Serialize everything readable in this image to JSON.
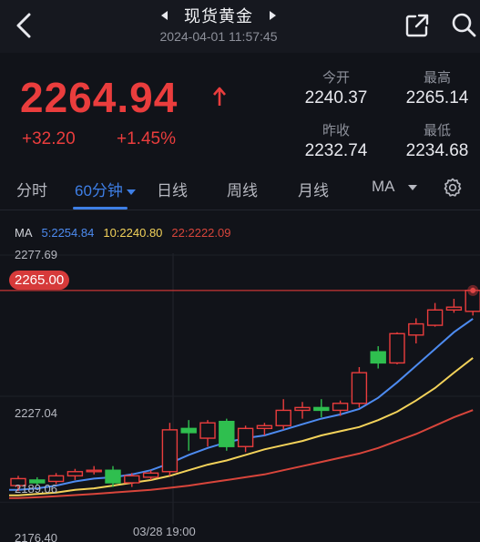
{
  "header": {
    "title": "现货黄金",
    "datetime": "2024-04-01 11:57:45"
  },
  "quote": {
    "price": "2264.94",
    "change": "+32.20",
    "change_pct": "+1.45%",
    "open_label": "今开",
    "open_value": "2240.37",
    "high_label": "最高",
    "high_value": "2265.14",
    "prev_close_label": "昨收",
    "prev_close_value": "2232.74",
    "low_label": "最低",
    "low_value": "2234.68"
  },
  "tabs": {
    "items": [
      "分时",
      "60分钟",
      "日线",
      "周线",
      "月线",
      "MA"
    ],
    "active": "60分钟"
  },
  "colors": {
    "up": "#ea3d3d",
    "down": "#2fbf4f",
    "accent": "#3e7fe6",
    "ma5": "#4d8bf0",
    "ma10": "#f3d25a",
    "ma22": "#d8453b"
  },
  "chart_data": {
    "type": "candlestick",
    "indicator_label": "MA",
    "ma_labels": {
      "ma5": "5:2254.84",
      "ma10": "10:2240.80",
      "ma22": "22:2222.09"
    },
    "y_ticks": [
      "2277.69",
      "2227.04",
      "2189.06",
      "2176.40"
    ],
    "current_price_tag": "2265.00",
    "x_tick": "03/28 19:00",
    "ylim": [
      2176.4,
      2277.69
    ],
    "candles": [
      {
        "o": 2195.0,
        "c": 2197.5,
        "h": 2198.5,
        "l": 2193.0
      },
      {
        "o": 2197.0,
        "c": 2196.0,
        "h": 2198.0,
        "l": 2195.0
      },
      {
        "o": 2196.5,
        "c": 2198.5,
        "h": 2199.5,
        "l": 2195.5
      },
      {
        "o": 2198.5,
        "c": 2200.0,
        "h": 2201.0,
        "l": 2197.0
      },
      {
        "o": 2200.0,
        "c": 2200.5,
        "h": 2202.0,
        "l": 2199.0
      },
      {
        "o": 2200.5,
        "c": 2196.0,
        "h": 2202.0,
        "l": 2194.5
      },
      {
        "o": 2196.0,
        "c": 2198.5,
        "h": 2199.5,
        "l": 2194.5
      },
      {
        "o": 2198.0,
        "c": 2199.5,
        "h": 2200.5,
        "l": 2197.0
      },
      {
        "o": 2200.0,
        "c": 2215.0,
        "h": 2217.5,
        "l": 2198.5
      },
      {
        "o": 2215.5,
        "c": 2214.0,
        "h": 2218.5,
        "l": 2207.5
      },
      {
        "o": 2212.0,
        "c": 2217.5,
        "h": 2218.5,
        "l": 2209.0
      },
      {
        "o": 2218.0,
        "c": 2209.0,
        "h": 2219.0,
        "l": 2207.5
      },
      {
        "o": 2209.0,
        "c": 2215.5,
        "h": 2216.5,
        "l": 2207.0
      },
      {
        "o": 2215.5,
        "c": 2216.5,
        "h": 2217.5,
        "l": 2213.0
      },
      {
        "o": 2216.5,
        "c": 2222.0,
        "h": 2226.0,
        "l": 2215.0
      },
      {
        "o": 2222.0,
        "c": 2223.0,
        "h": 2225.0,
        "l": 2219.0
      },
      {
        "o": 2223.0,
        "c": 2222.0,
        "h": 2226.0,
        "l": 2219.5
      },
      {
        "o": 2222.0,
        "c": 2224.5,
        "h": 2225.5,
        "l": 2220.0
      },
      {
        "o": 2224.5,
        "c": 2235.5,
        "h": 2237.5,
        "l": 2223.0
      },
      {
        "o": 2243.0,
        "c": 2239.0,
        "h": 2245.0,
        "l": 2237.0
      },
      {
        "o": 2239.0,
        "c": 2249.5,
        "h": 2250.0,
        "l": 2238.5
      },
      {
        "o": 2249.0,
        "c": 2253.0,
        "h": 2255.0,
        "l": 2246.0
      },
      {
        "o": 2252.5,
        "c": 2258.0,
        "h": 2260.5,
        "l": 2252.0
      },
      {
        "o": 2258.0,
        "c": 2259.0,
        "h": 2262.0,
        "l": 2257.0
      },
      {
        "o": 2257.5,
        "c": 2265.0,
        "h": 2266.0,
        "l": 2256.0
      }
    ],
    "ma5": [
      2193.5,
      2194.0,
      2195.0,
      2196.5,
      2197.5,
      2198.0,
      2199.0,
      2200.5,
      2203.0,
      2206.0,
      2208.5,
      2210.5,
      2212.0,
      2213.0,
      2215.0,
      2217.0,
      2219.0,
      2220.5,
      2222.5,
      2226.5,
      2232.0,
      2238.0,
      2244.0,
      2250.0,
      2254.84
    ],
    "ma10": [
      2191.5,
      2192.0,
      2192.5,
      2193.5,
      2194.0,
      2195.0,
      2196.0,
      2197.0,
      2198.5,
      2200.5,
      2202.5,
      2204.0,
      2206.0,
      2208.0,
      2209.5,
      2211.0,
      2213.0,
      2214.5,
      2216.0,
      2218.5,
      2221.5,
      2225.5,
      2230.0,
      2235.5,
      2240.8
    ],
    "ma22": [
      2190.5,
      2190.8,
      2191.2,
      2191.6,
      2192.0,
      2192.5,
      2193.0,
      2193.5,
      2194.2,
      2195.0,
      2196.0,
      2197.0,
      2198.0,
      2199.0,
      2200.5,
      2202.0,
      2203.5,
      2205.0,
      2206.5,
      2208.5,
      2211.0,
      2213.5,
      2216.5,
      2219.5,
      2222.09
    ]
  }
}
